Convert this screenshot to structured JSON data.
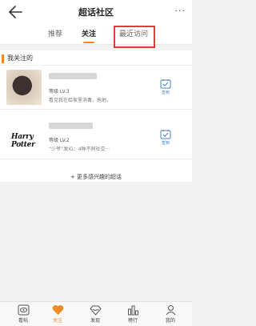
{
  "header": {
    "title": "超话社区",
    "more_label": "···"
  },
  "tabs": [
    {
      "label": "推荐"
    },
    {
      "label": "关注"
    },
    {
      "label": "最近访问"
    }
  ],
  "section": {
    "title": "我关注的"
  },
  "follows": [
    {
      "level": "等级 LV.3",
      "desc": "看见我在给家里消毒，拖地，"
    },
    {
      "logo_text": "Harry Potter",
      "level": "等级 LV.2",
      "desc": "“少爷”发IG：4种不同社交···"
    }
  ],
  "signin_label": "签到",
  "more_link": "+ 更多感兴趣的超话",
  "bottom_nav": [
    {
      "label": "看帖"
    },
    {
      "label": "关注"
    },
    {
      "label": "发现"
    },
    {
      "label": "榜行"
    },
    {
      "label": "我的"
    }
  ],
  "colors": {
    "accent": "#f08a24",
    "highlight_box": "#e23a3a",
    "signin_blue": "#4a7fc1"
  }
}
